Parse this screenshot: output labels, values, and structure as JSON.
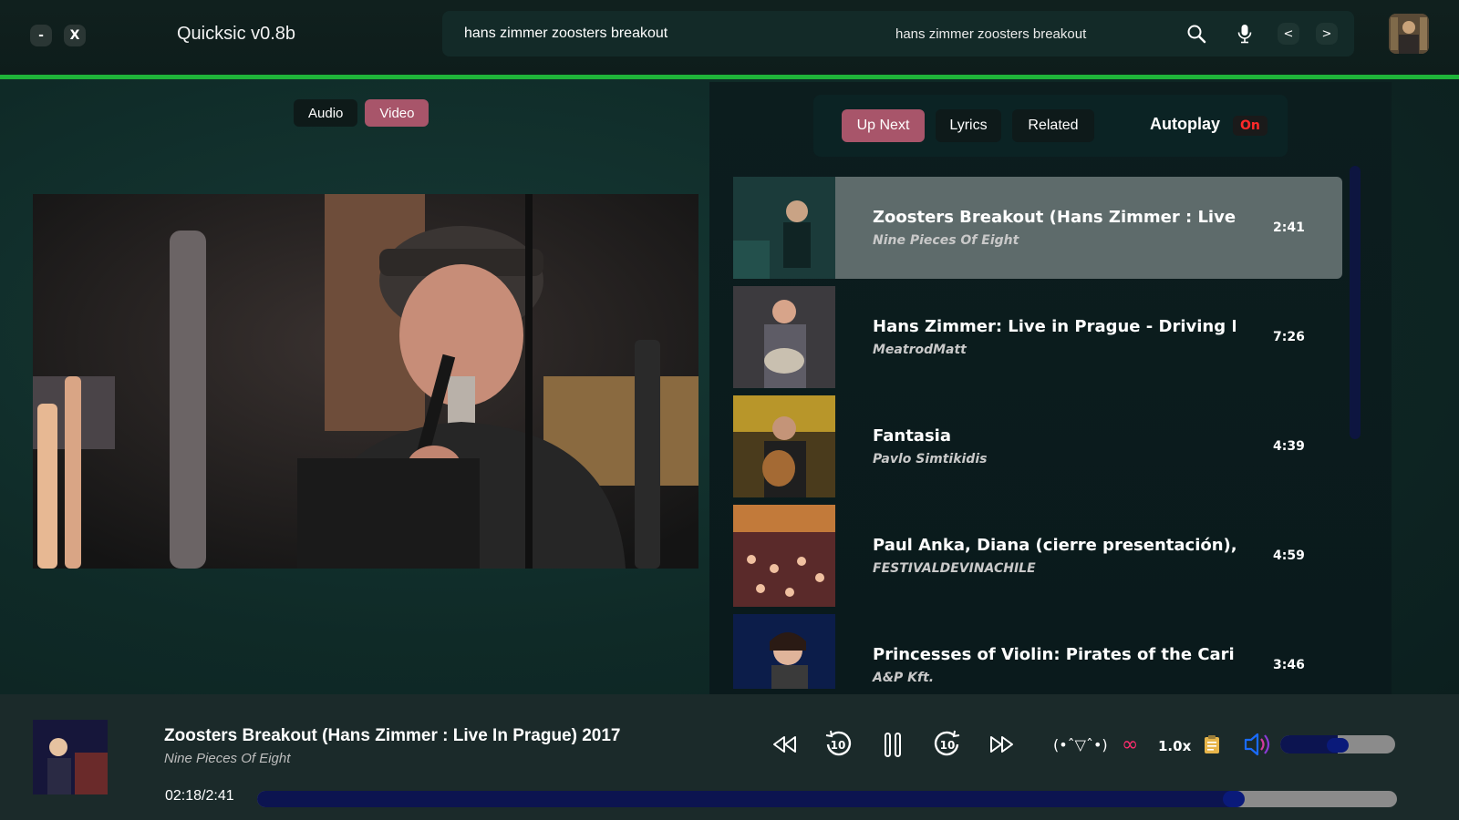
{
  "app": {
    "title": "Quicksic v0.8b"
  },
  "window_controls": {
    "minimize": "-",
    "close": "X"
  },
  "search": {
    "value": "hans zimmer zoosters breakout",
    "echo": "hans zimmer zoosters breakout",
    "search_icon": "search-icon",
    "mic_icon": "microphone-icon",
    "back_label": "<",
    "forward_label": ">"
  },
  "mode": {
    "audio_label": "Audio",
    "video_label": "Video",
    "active": "Video"
  },
  "tabs": [
    {
      "label": "Up Next",
      "active": true
    },
    {
      "label": "Lyrics",
      "active": false
    },
    {
      "label": "Related",
      "active": false
    }
  ],
  "autoplay": {
    "label": "Autoplay",
    "state": "On"
  },
  "queue": [
    {
      "title": "Zoosters Breakout (Hans Zimmer : Live In",
      "artist": "Nine Pieces Of Eight",
      "duration": "2:41",
      "current": true
    },
    {
      "title": "Hans Zimmer: Live in Prague - Driving Mis",
      "artist": "MeatrodMatt",
      "duration": "7:26",
      "current": false
    },
    {
      "title": "Fantasia",
      "artist": "Pavlo Simtikidis",
      "duration": "4:39",
      "current": false
    },
    {
      "title": "Paul Anka, Diana (cierre presentación), Fe:",
      "artist": "FESTIVALDEVINACHILE",
      "duration": "4:59",
      "current": false
    },
    {
      "title": "Princesses of Violin: Pirates of the Caribbe",
      "artist": "A&P Kft.",
      "duration": "3:46",
      "current": false
    }
  ],
  "player": {
    "title": "Zoosters Breakout (Hans Zimmer : Live In Prague) 2017",
    "artist": "Nine Pieces Of Eight",
    "time_display": "02:18/2:41",
    "progress_fraction": 0.857,
    "emoticon": "(•ˆ▽ˆ•)",
    "loop_symbol": "∞",
    "speed": "1.0x",
    "volume_fraction": 0.5,
    "controls": [
      "skip-previous-icon",
      "rewind-10-icon",
      "pause-icon",
      "forward-10-icon",
      "skip-next-icon"
    ]
  },
  "colors": {
    "accent_green": "#1fb53a",
    "active_tab": "#a8556a",
    "autoplay_on": "#ff2a2a",
    "loop": "#ff2d6e",
    "progress": "#0c1450"
  }
}
